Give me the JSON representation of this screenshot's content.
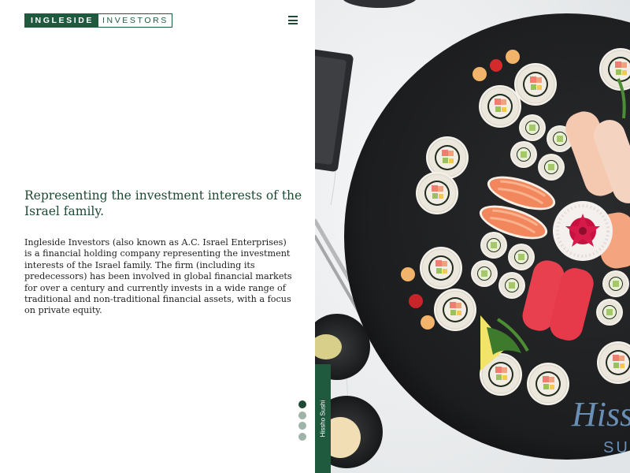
{
  "header": {
    "logo_part1": "INGLESIDE",
    "logo_part2": "INVESTORS",
    "menu_icon": "hamburger-icon"
  },
  "main": {
    "headline": "Representing the investment interests of the Israel family.",
    "description": "Ingleside Investors (also known as A.C. Israel Enterprises) is a financial holding company representing the investment interests of the Israel family. The firm (including its predecessors) has been involved in global financial markets for over a century and currently invests in a wide range of traditional and non-traditional financial assets, with a focus on private equity."
  },
  "slider": {
    "dot_count": 4,
    "active_index": 0,
    "caption": "Hissho Sushi",
    "image_text_line1": "Hissho",
    "image_text_line2": "SUSHI"
  },
  "colors": {
    "brand_green": "#1f5a3f",
    "dot_active": "#1f4a35",
    "dot_inactive": "#9fb3a8"
  }
}
